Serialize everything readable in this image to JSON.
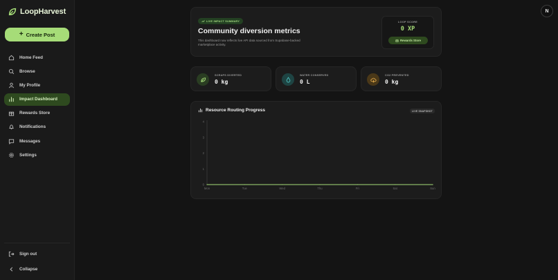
{
  "app": {
    "name": "LoopHarvest"
  },
  "sidebar": {
    "create_label": "Create Post",
    "items": [
      {
        "label": "Home Feed",
        "icon": "home-icon",
        "active": false
      },
      {
        "label": "Browse",
        "icon": "search-icon",
        "active": false
      },
      {
        "label": "My Profile",
        "icon": "user-icon",
        "active": false
      },
      {
        "label": "Impact Dashboard",
        "icon": "bar-chart-icon",
        "active": true
      },
      {
        "label": "Rewards Store",
        "icon": "gift-icon",
        "active": false
      },
      {
        "label": "Notifications",
        "icon": "bell-icon",
        "active": false
      },
      {
        "label": "Messages",
        "icon": "message-icon",
        "active": false
      },
      {
        "label": "Settings",
        "icon": "gear-icon",
        "active": false
      }
    ],
    "bottom": [
      {
        "label": "Sign out",
        "icon": "sign-out-icon"
      },
      {
        "label": "Collapse",
        "icon": "chevron-left-icon"
      }
    ]
  },
  "user": {
    "avatar_initial": "N"
  },
  "hero": {
    "badge": "LIVE IMPACT SUMMARY",
    "title": "Community diversion metrics",
    "description": "This dashboard now reflects live API data sourced from Supabase-backed marketplace activity.",
    "loop_score_label": "LOOP SCORE",
    "loop_score_value": "0 XP",
    "rewards_label": "Rewards Store"
  },
  "stats": [
    {
      "label": "SCRAPS DIVERTED",
      "value": "0 kg",
      "icon": "leaf-icon",
      "color": "#a6dc78"
    },
    {
      "label": "WATER CONSERVED",
      "value": "0 L",
      "icon": "droplet-icon",
      "color": "#4fc3c0"
    },
    {
      "label": "CO2 PREVENTED",
      "value": "0 kg",
      "icon": "cloud-icon",
      "color": "#e0a94a"
    }
  ],
  "chart": {
    "title": "Resource Routing Progress",
    "badge": "LIVE SNAPSHOT"
  },
  "chart_data": {
    "type": "line",
    "categories": [
      "Mon",
      "Tue",
      "Wed",
      "Thu",
      "Fri",
      "Sat",
      "Sun"
    ],
    "values": [
      0,
      0,
      0,
      0,
      0,
      0,
      0
    ],
    "yticks": [
      0,
      1,
      2,
      3,
      4
    ],
    "ylim": [
      0,
      4
    ],
    "title": "",
    "xlabel": "",
    "ylabel": "",
    "grid": false,
    "line_color": "#a6dc78"
  }
}
